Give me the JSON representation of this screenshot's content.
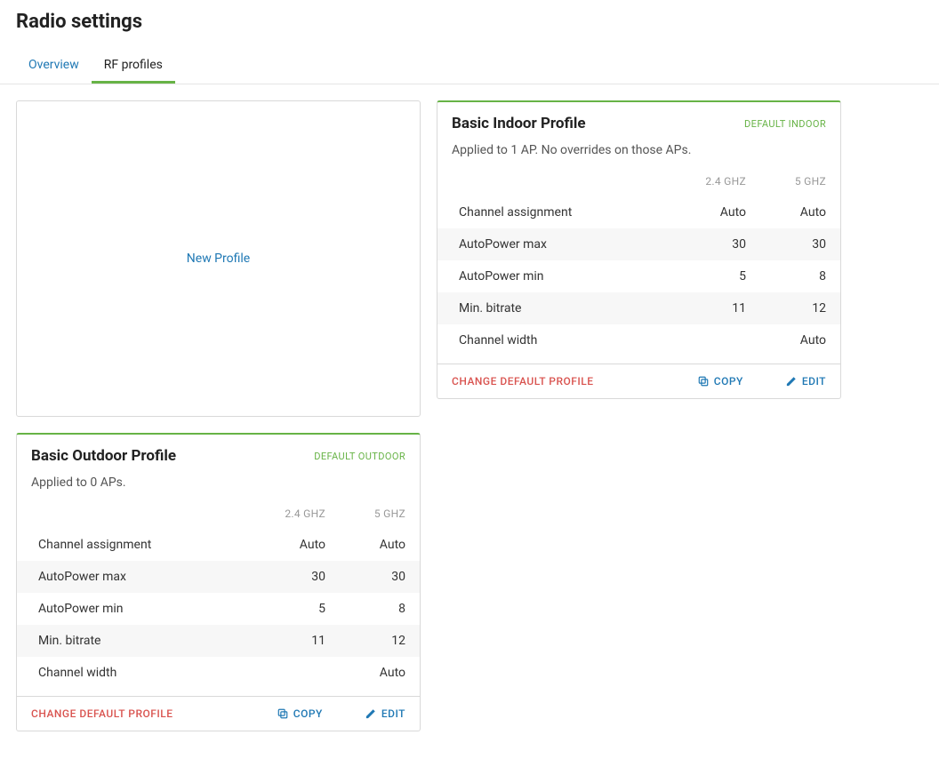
{
  "page": {
    "title": "Radio settings"
  },
  "tabs": {
    "overview": "Overview",
    "rfprofiles": "RF profiles"
  },
  "newProfile": {
    "label": "New Profile"
  },
  "columns": {
    "band24": "2.4 GHZ",
    "band5": "5 GHZ"
  },
  "rows": {
    "channelAssignment": "Channel assignment",
    "autoPowerMax": "AutoPower max",
    "autoPowerMin": "AutoPower min",
    "minBitrate": "Min. bitrate",
    "channelWidth": "Channel width"
  },
  "actions": {
    "changeDefault": "CHANGE DEFAULT PROFILE",
    "copy": "COPY",
    "edit": "EDIT"
  },
  "indoor": {
    "name": "Basic Indoor Profile",
    "badge": "DEFAULT INDOOR",
    "applied": "Applied to 1 AP. No overrides on those APs.",
    "channelAssignment": {
      "b24": "Auto",
      "b5": "Auto"
    },
    "autoPowerMax": {
      "b24": "30",
      "b5": "30"
    },
    "autoPowerMin": {
      "b24": "5",
      "b5": "8"
    },
    "minBitrate": {
      "b24": "11",
      "b5": "12"
    },
    "channelWidth": {
      "b24": "",
      "b5": "Auto"
    }
  },
  "outdoor": {
    "name": "Basic Outdoor Profile",
    "badge": "DEFAULT OUTDOOR",
    "applied": "Applied to 0 APs.",
    "channelAssignment": {
      "b24": "Auto",
      "b5": "Auto"
    },
    "autoPowerMax": {
      "b24": "30",
      "b5": "30"
    },
    "autoPowerMin": {
      "b24": "5",
      "b5": "8"
    },
    "minBitrate": {
      "b24": "11",
      "b5": "12"
    },
    "channelWidth": {
      "b24": "",
      "b5": "Auto"
    }
  }
}
